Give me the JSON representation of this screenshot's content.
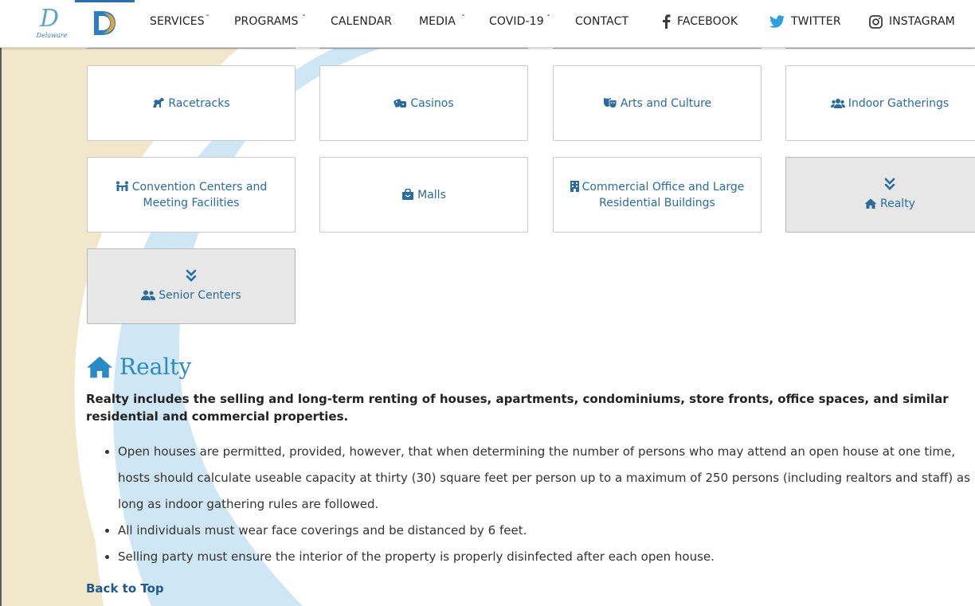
{
  "brand": {
    "logo_script": "D",
    "logo_word": "Delaware"
  },
  "nav": {
    "services": "SERVICES",
    "programs": "PROGRAMS",
    "calendar": "CALENDAR",
    "media": "MEDIA",
    "covid": "COVID-19",
    "contact": "CONTACT",
    "facebook": "FACEBOOK",
    "twitter": "TWITTER",
    "instagram": "INSTAGRAM"
  },
  "cards": {
    "racetracks": "Racetracks",
    "casinos": "Casinos",
    "arts": "Arts and Culture",
    "indoor": "Indoor Gatherings",
    "convention": "Convention Centers and Meeting Facilities",
    "malls": "Malls",
    "commercial": "Commercial Office and Large Residential Buildings",
    "realty": "Realty",
    "senior": "Senior Centers"
  },
  "section": {
    "title": "Realty",
    "intro": "Realty includes the selling and long-term renting of houses, apartments, condominiums, store fronts, office spaces, and similar residential and commercial properties.",
    "bullets": [
      "Open houses are permitted, provided, however, that when determining the number of persons who may attend an open house at one time, hosts should calculate useable capacity at thirty (30) square feet per person up to a maximum of 250 persons (including realtors and staff) as long as indoor gathering rules are followed.",
      "All individuals must wear face coverings and be distanced by 6 feet.",
      "Selling party must ensure the interior of the property is properly disinfected after each open house."
    ],
    "back_to_top": "Back to Top"
  },
  "colors": {
    "link_blue": "#2b6b9e",
    "title_blue": "#2b8ac6",
    "swoosh_beige": "#f0e6c8",
    "swoosh_blue": "#cde6f5"
  }
}
